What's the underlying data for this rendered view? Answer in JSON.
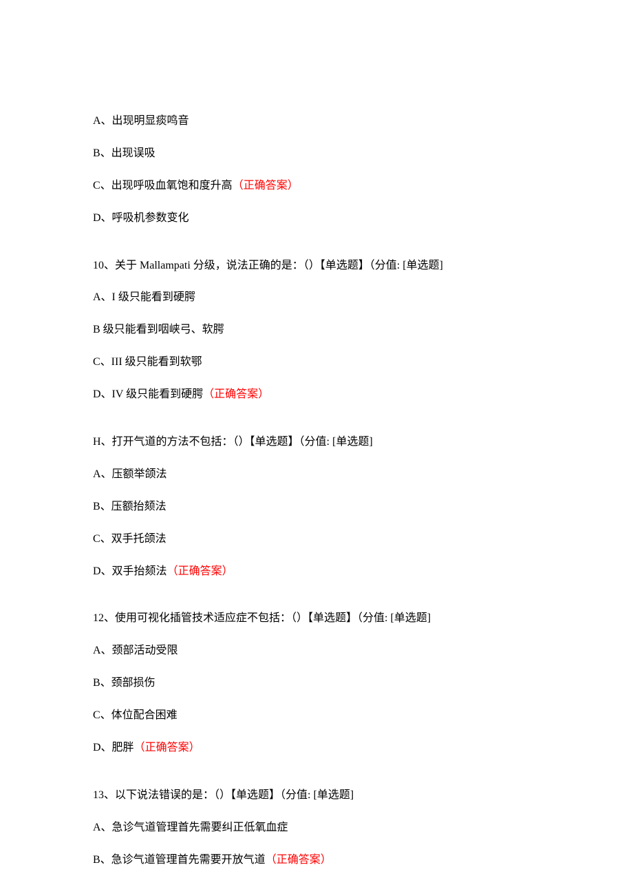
{
  "correct_label": "（正确答案）",
  "q9_tail": {
    "options": [
      {
        "text": "A、出现明显痰鸣音",
        "correct": false
      },
      {
        "text": "B、出现误吸",
        "correct": false
      },
      {
        "text": "C、出现呼吸血氧饱和度升高",
        "correct": true
      },
      {
        "text": "D、呼吸机参数变化",
        "correct": false
      }
    ]
  },
  "q10": {
    "stem": "10、关于 Mallampati 分级，说法正确的是：（）【单选题】（分值: [单选题]",
    "options": [
      {
        "text": "A、I 级只能看到硬腭",
        "correct": false
      },
      {
        "text": "B 级只能看到咽峡弓、软腭",
        "correct": false
      },
      {
        "text": "C、III 级只能看到软鄂",
        "correct": false
      },
      {
        "text": "D、IV 级只能看到硬腭",
        "correct": true
      }
    ]
  },
  "q11": {
    "stem": "H、打开气道的方法不包括：（）【单选题】（分值: [单选题]",
    "options": [
      {
        "text": "A、压额举颌法",
        "correct": false
      },
      {
        "text": "B、压额抬颏法",
        "correct": false
      },
      {
        "text": "C、双手托颌法",
        "correct": false
      },
      {
        "text": "D、双手抬颏法",
        "correct": true
      }
    ]
  },
  "q12": {
    "stem": "12、使用可视化插管技术适应症不包括：（）【单选题】（分值: [单选题]",
    "options": [
      {
        "text": "A、颈部活动受限",
        "correct": false
      },
      {
        "text": "B、颈部损伤",
        "correct": false
      },
      {
        "text": "C、体位配合困难",
        "correct": false
      },
      {
        "text": "D、肥胖",
        "correct": true
      }
    ]
  },
  "q13": {
    "stem": "13、以下说法错误的是：（）【单选题】（分值: [单选题]",
    "options": [
      {
        "text": "A、急诊气道管理首先需要纠正低氧血症",
        "correct": false
      },
      {
        "text": "B、急诊气道管理首先需要开放气道",
        "correct": true
      }
    ]
  }
}
